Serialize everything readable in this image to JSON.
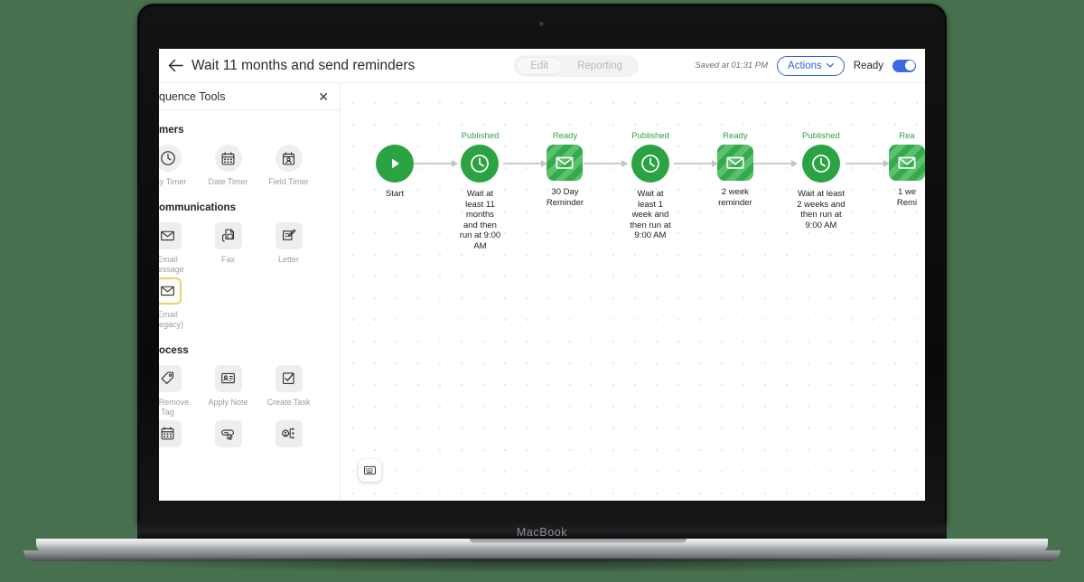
{
  "device": {
    "brand_label": "MacBook"
  },
  "header": {
    "back_icon": "arrow-left-icon",
    "title": "Wait 11 months and send reminders",
    "segments": [
      {
        "label": "Edit",
        "active": true
      },
      {
        "label": "Reporting",
        "active": false
      }
    ],
    "saved_text": "Saved at 01:31 PM",
    "actions_label": "Actions",
    "actions_chevron": "chevron-down-icon",
    "ready_label": "Ready",
    "toggle_on": true,
    "accent_blue": "#2f5fe0"
  },
  "sidebar": {
    "title": "quence Tools",
    "close_icon": "close-icon",
    "sections": [
      {
        "title": "mers",
        "shape": "round",
        "tools": [
          {
            "label": "elay Timer",
            "icon": "clock-icon",
            "selected": false
          },
          {
            "label": "Date Timer",
            "icon": "calendar-icon",
            "selected": false
          },
          {
            "label": "Field Timer",
            "icon": "calendar-person-icon",
            "selected": false
          }
        ]
      },
      {
        "title": "ommunications",
        "shape": "sq",
        "tools": [
          {
            "label": "Email\nmessage",
            "icon": "envelope-icon",
            "selected": false
          },
          {
            "label": "Fax",
            "icon": "fax-icon",
            "selected": false
          },
          {
            "label": "Letter",
            "icon": "letter-pencil-icon",
            "selected": false
          },
          {
            "label": "Email\n(Legacy)",
            "icon": "envelope-icon",
            "selected": true
          }
        ]
      },
      {
        "title": "ocess",
        "shape": "sq",
        "tools": [
          {
            "label": "ply/Remove\nTag",
            "icon": "tag-icon",
            "selected": false
          },
          {
            "label": "Apply Note",
            "icon": "note-card-icon",
            "selected": false
          },
          {
            "label": "Create Task",
            "icon": "checkbox-task-icon",
            "selected": false
          },
          {
            "label": "",
            "icon": "calendar-icon",
            "selected": false
          },
          {
            "label": "",
            "icon": "button-click-icon",
            "selected": false
          },
          {
            "label": "",
            "icon": "decision-branch-icon",
            "selected": false
          }
        ]
      }
    ],
    "selected_border_color": "#e8d26a"
  },
  "canvas": {
    "minimap_icon": "minimap-icon",
    "status_color": "#34a042",
    "node_green": "#2ba343",
    "nodes": [
      {
        "status": "",
        "type": "start",
        "icon": "play-icon",
        "label": "Start"
      },
      {
        "status": "Published",
        "type": "timer",
        "icon": "clock-icon",
        "label": "Wait at least 11 months\nand then run at 9:00 AM"
      },
      {
        "status": "Ready",
        "type": "email",
        "icon": "envelope-icon",
        "label": "30 Day\nReminder"
      },
      {
        "status": "Published",
        "type": "timer",
        "icon": "clock-icon",
        "label": "Wait at least 1 week and\nthen run at 9:00 AM"
      },
      {
        "status": "Ready",
        "type": "email",
        "icon": "envelope-icon",
        "label": "2 week\nreminder"
      },
      {
        "status": "Published",
        "type": "timer",
        "icon": "clock-icon",
        "label": "Wait at least 2 weeks and\nthen run at 9:00 AM"
      },
      {
        "status": "Rea",
        "type": "email",
        "icon": "envelope-icon",
        "label": "1 we\nRemi"
      }
    ]
  }
}
